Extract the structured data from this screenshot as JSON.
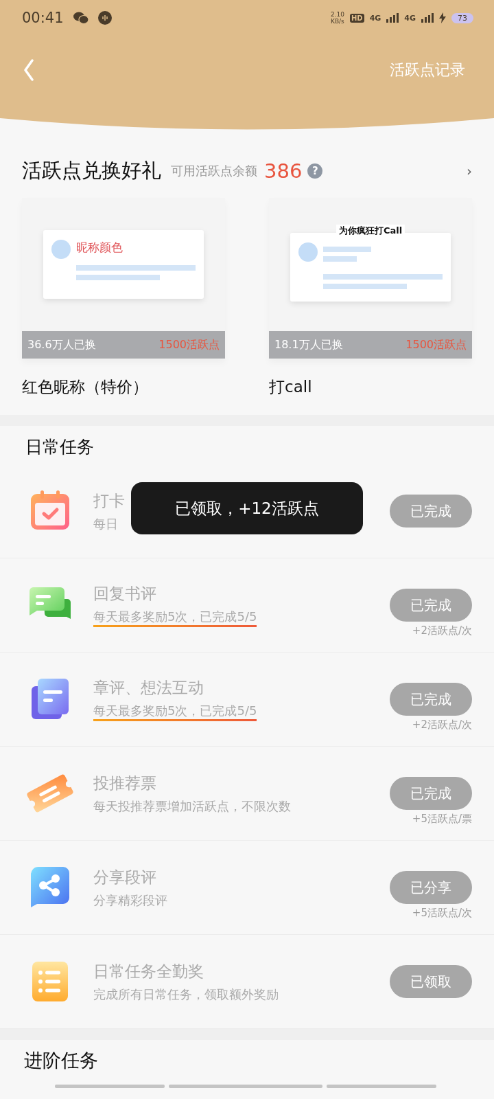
{
  "status_bar": {
    "time": "00:41",
    "net_speed": "2.10",
    "net_unit": "KB/s",
    "hd": "HD",
    "networks": [
      "4G",
      "4G"
    ],
    "battery": "73"
  },
  "header": {
    "link": "活跃点记录"
  },
  "exchange": {
    "title": "活跃点兑换好礼",
    "balance_label": "可用活跃点余额",
    "balance": "386",
    "help": "?",
    "more": "›",
    "items": [
      {
        "preview": {
          "kind": "nickname",
          "text": "昵称颜色"
        },
        "exchanged": "36.6万人已换",
        "price": "1500活跃点",
        "name": "红色昵称（特价）"
      },
      {
        "preview": {
          "kind": "call",
          "text": "为你疯狂打Call"
        },
        "exchanged": "18.1万人已换",
        "price": "1500活跃点",
        "name": "打call"
      }
    ]
  },
  "daily": {
    "title": "日常任务",
    "tasks": [
      {
        "kind": "calendar",
        "title": "打卡",
        "desc": "每日",
        "button": "已完成",
        "disabled": true
      },
      {
        "kind": "chat",
        "title": "回复书评",
        "desc": "每天最多奖励5次，已完成5/5",
        "highlighted": true,
        "button": "已完成",
        "disabled": true,
        "reward": "+2活跃点/次"
      },
      {
        "kind": "document",
        "title": "章评、想法互动",
        "desc": "每天最多奖励5次，已完成5/5",
        "highlighted": true,
        "button": "已完成",
        "disabled": true,
        "reward": "+2活跃点/次"
      },
      {
        "kind": "ticket",
        "title": "投推荐票",
        "desc": "每天投推荐票增加活跃点，不限次数",
        "button": "已完成",
        "disabled": true,
        "reward": "+5活跃点/票"
      },
      {
        "kind": "share",
        "title": "分享段评",
        "desc": "分享精彩段评",
        "button": "已分享",
        "disabled": true,
        "reward": "+5活跃点/次"
      },
      {
        "kind": "list",
        "title": "日常任务全勤奖",
        "desc": "完成所有日常任务，领取额外奖励",
        "button": "已领取",
        "disabled": true
      }
    ]
  },
  "toast": "已领取，+12活跃点",
  "advanced": {
    "title": "进阶任务"
  }
}
